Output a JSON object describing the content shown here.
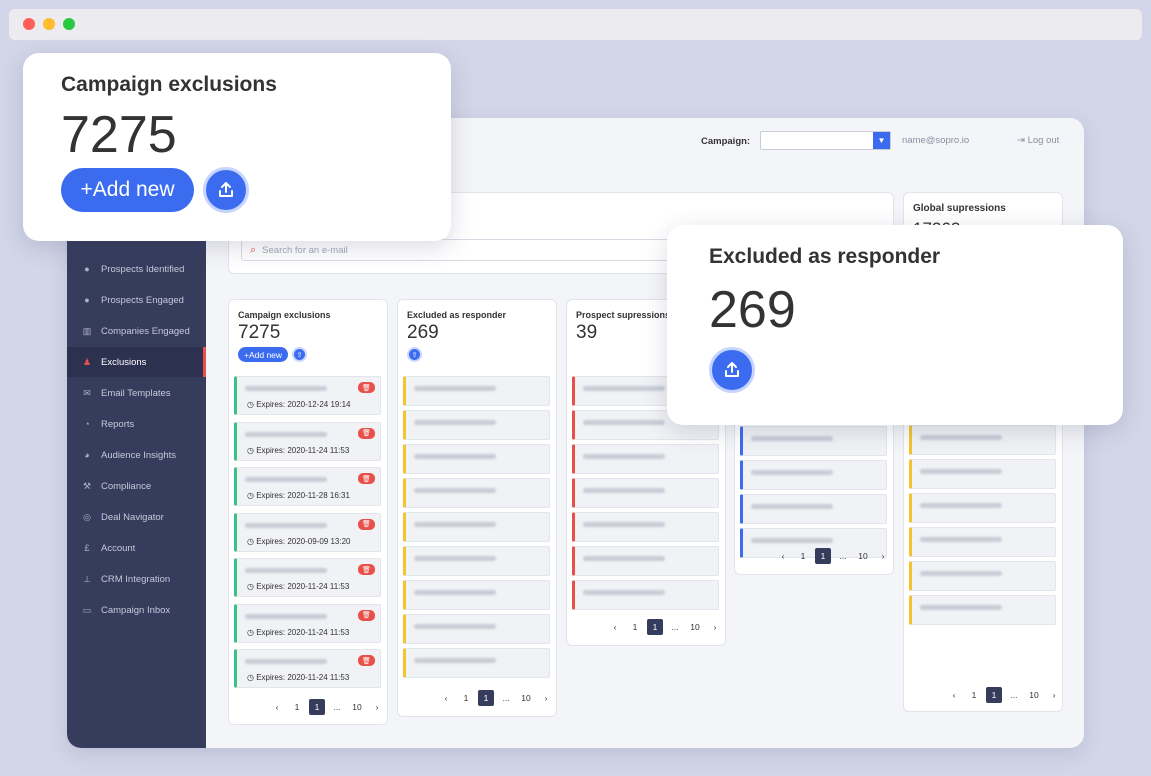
{
  "topbar": {
    "campaign_label": "Campaign:",
    "user_email": "name@sopro.io",
    "logout": "Log out"
  },
  "sidebar": {
    "items": [
      {
        "label": "Prospects Identified",
        "icon": "p-circle-icon"
      },
      {
        "label": "Prospects Engaged",
        "icon": "p-circle-icon"
      },
      {
        "label": "Companies Engaged",
        "icon": "building-icon"
      },
      {
        "label": "Exclusions",
        "icon": "user-minus-icon",
        "active": true
      },
      {
        "label": "Email Templates",
        "icon": "envelope-icon"
      },
      {
        "label": "Reports",
        "icon": "chart-icon"
      },
      {
        "label": "Audience Insights",
        "icon": "pie-icon"
      },
      {
        "label": "Compliance",
        "icon": "gavel-icon"
      },
      {
        "label": "Deal Navigator",
        "icon": "compass-icon"
      },
      {
        "label": "Account",
        "icon": "pound-icon"
      },
      {
        "label": "CRM Integration",
        "icon": "sitemap-icon"
      },
      {
        "label": "Campaign Inbox",
        "icon": "inbox-icon"
      }
    ]
  },
  "search": {
    "placeholder": "Search for an e-mail"
  },
  "global": {
    "title": "Global supressions",
    "count_partial": "17262"
  },
  "columns": {
    "campaign": {
      "title": "Campaign exclusions",
      "count": "7275",
      "add_label": "+Add new",
      "expiries": [
        "Expires: 2020-12-24 19:14",
        "Expires: 2020-11-24 11:53",
        "Expires: 2020-11-28 16:31",
        "Expires: 2020-09-09 13:20",
        "Expires: 2020-11-24 11:53",
        "Expires: 2020-11-24 11:53",
        "Expires: 2020-11-24 11:53"
      ]
    },
    "responder": {
      "title": "Excluded as responder",
      "count": "269"
    },
    "prospect": {
      "title": "Prospect supressions",
      "count": "39"
    }
  },
  "pagination": {
    "first": "1",
    "current": "1",
    "ellipsis": "...",
    "last": "10",
    "prev": "‹",
    "next": "›"
  },
  "callout_campaign": {
    "title": "Campaign exclusions",
    "count": "7275",
    "add_label": "+Add new"
  },
  "callout_responder": {
    "title": "Excluded as responder",
    "count": "269"
  },
  "colors": {
    "accent": "#3b6cf0",
    "sidebar": "#363c5c",
    "danger": "#e8504a",
    "green": "#3cc08a",
    "yellow": "#f4c430"
  }
}
